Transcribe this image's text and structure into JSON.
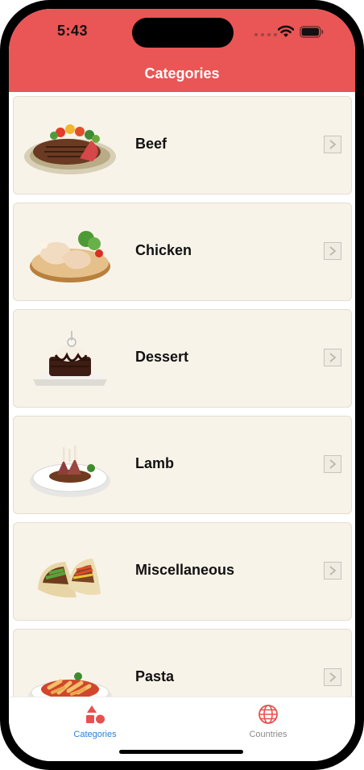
{
  "status_bar": {
    "time": "5:43"
  },
  "nav": {
    "title": "Categories"
  },
  "categories": [
    {
      "label": "Beef"
    },
    {
      "label": "Chicken"
    },
    {
      "label": "Dessert"
    },
    {
      "label": "Lamb"
    },
    {
      "label": "Miscellaneous"
    },
    {
      "label": "Pasta"
    }
  ],
  "tabbar": {
    "tabs": [
      {
        "label": "Categories",
        "icon": "shapes-icon",
        "active": true
      },
      {
        "label": "Countries",
        "icon": "globe-icon",
        "active": false
      }
    ]
  },
  "colors": {
    "header": "#ea5555",
    "row_background": "#f8f3e9",
    "tab_active": "#2f7fd2",
    "tab_inactive": "#8a8a8a",
    "icon_red": "#e85050"
  }
}
